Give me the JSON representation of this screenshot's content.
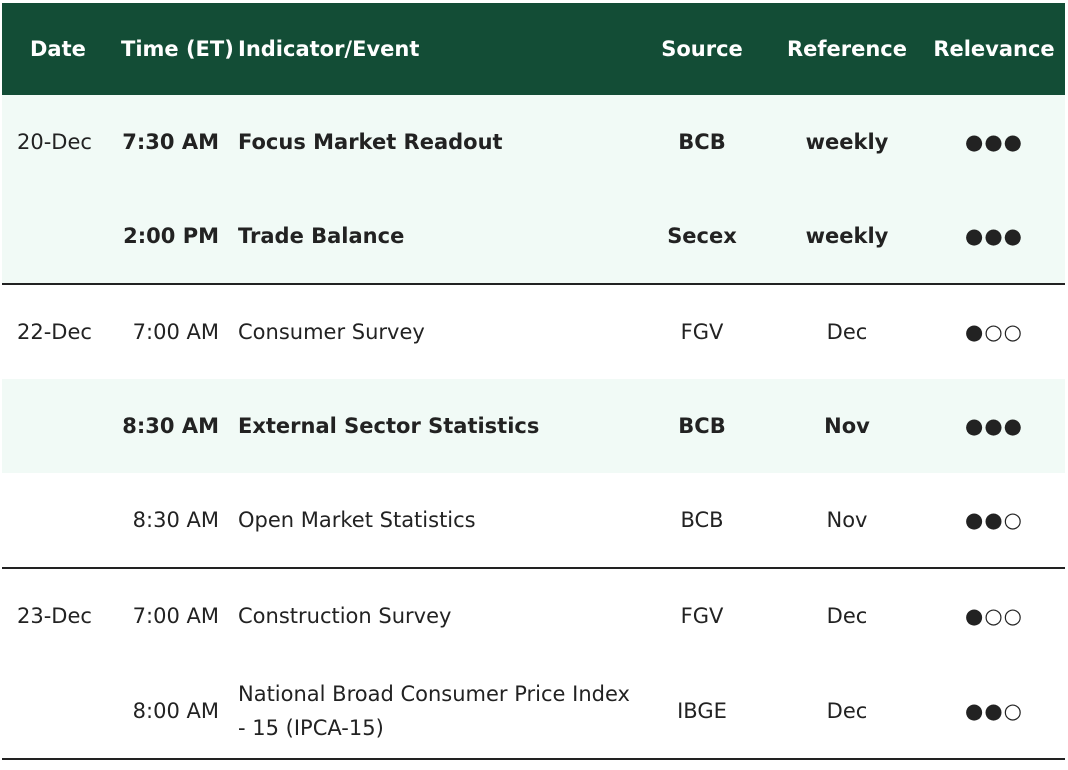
{
  "header": {
    "date": "Date",
    "time": "Time (ET)",
    "event": "Indicator/Event",
    "source": "Source",
    "reference": "Reference",
    "relevance": "Relevance"
  },
  "rows": [
    {
      "date": "20-Dec",
      "time": "7:30 AM",
      "event": "Focus Market Readout",
      "source": "BCB",
      "reference": "weekly",
      "relevance": "●●●"
    },
    {
      "date": "",
      "time": "2:00 PM",
      "event": "Trade Balance",
      "source": "Secex",
      "reference": "weekly",
      "relevance": "●●●"
    },
    {
      "date": "22-Dec",
      "time": "7:00 AM",
      "event": "Consumer Survey",
      "source": "FGV",
      "reference": "Dec",
      "relevance": "●○○"
    },
    {
      "date": "",
      "time": "8:30 AM",
      "event": "External Sector Statistics",
      "source": "BCB",
      "reference": "Nov",
      "relevance": "●●●"
    },
    {
      "date": "",
      "time": "8:30 AM",
      "event": "Open Market Statistics",
      "source": "BCB",
      "reference": "Nov",
      "relevance": "●●○"
    },
    {
      "date": "23-Dec",
      "time": "7:00 AM",
      "event": "Construction Survey",
      "source": "FGV",
      "reference": "Dec",
      "relevance": "●○○"
    },
    {
      "date": "",
      "time": "8:00 AM",
      "event": "National Broad Consumer Price Index - 15 (IPCA-15)",
      "source": "IBGE",
      "reference": "Dec",
      "relevance": "●●○"
    }
  ],
  "colors": {
    "header_bg": "#134d36",
    "highlight_bg": "#f1faf6",
    "text": "#222222"
  }
}
